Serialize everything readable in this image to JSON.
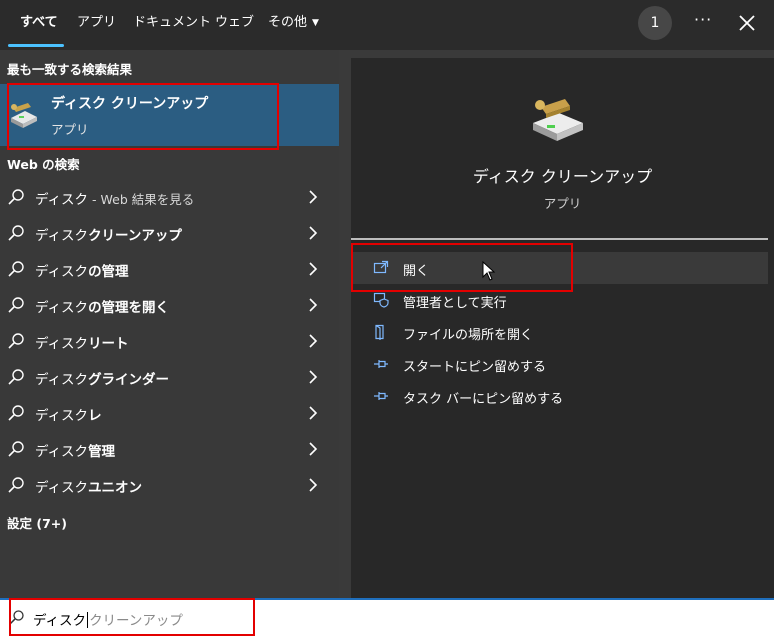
{
  "tabs": [
    {
      "label": "すべて",
      "active": true
    },
    {
      "label": "アプリ"
    },
    {
      "label": "ドキュメント"
    },
    {
      "label": "ウェブ"
    },
    {
      "label": "その他"
    }
  ],
  "topbar": {
    "badge_count": "1",
    "more_label": "···"
  },
  "left": {
    "best_match_header": "最も一致する検索結果",
    "best_match": {
      "title": "ディスク クリーンアップ",
      "subtitle": "アプリ"
    },
    "web_header": "Web の検索",
    "web_items": [
      {
        "plain": "ディスク",
        "bold": "",
        "dim": " - Web 結果を見る"
      },
      {
        "plain": "ディスク",
        "bold": "クリーンアップ",
        "dim": ""
      },
      {
        "plain": "ディスク",
        "bold": "の管理",
        "dim": ""
      },
      {
        "plain": "ディスク",
        "bold": "の管理を開く",
        "dim": ""
      },
      {
        "plain": "ディスク",
        "bold": "リート",
        "dim": ""
      },
      {
        "plain": "ディスク",
        "bold": "グラインダー",
        "dim": ""
      },
      {
        "plain": "ディスク",
        "bold": "レ",
        "dim": ""
      },
      {
        "plain": "ディスク",
        "bold": "管理",
        "dim": ""
      },
      {
        "plain": "ディスク",
        "bold": "ユニオン",
        "dim": ""
      }
    ],
    "settings_header": "設定 (7+)"
  },
  "right": {
    "app_title": "ディスク クリーンアップ",
    "app_subtitle": "アプリ",
    "actions": [
      {
        "label": "開く",
        "icon": "open-icon"
      },
      {
        "label": "管理者として実行",
        "icon": "admin-shield-icon"
      },
      {
        "label": "ファイルの場所を開く",
        "icon": "file-location-icon"
      },
      {
        "label": "スタートにピン留めする",
        "icon": "pin-icon"
      },
      {
        "label": "タスク バーにピン留めする",
        "icon": "pin-icon"
      }
    ]
  },
  "search": {
    "typed": "ディスク",
    "suggestion": "クリーンアップ"
  },
  "colors": {
    "accent": "#4cc2ff",
    "selection": "#2b5d82",
    "annotation": "#e30000"
  }
}
